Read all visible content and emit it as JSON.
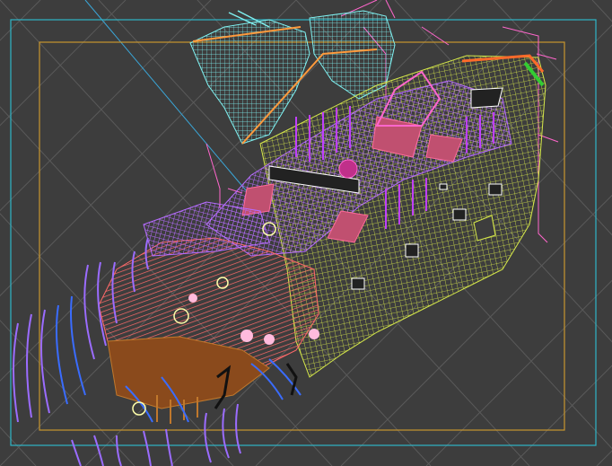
{
  "viewport": {
    "background": "#3d3d3d",
    "grid_color": "#5a5a5a",
    "safe_frame_outer_color": "#2fb6c8",
    "safe_frame_inner_color": "#c8962e",
    "camera_line_color": "#3aa6d8"
  },
  "model": {
    "hull_color": "#d6e84a",
    "deck_color": "#ff6a6a",
    "cabin_color": "#b66cff",
    "sail_color": "#7ff0f0",
    "rigging_color": "#ff66cc",
    "ribs_color": "#3a6cff",
    "bow_ribs_color": "#9b6cff",
    "rudder_color": "#c0782c"
  }
}
